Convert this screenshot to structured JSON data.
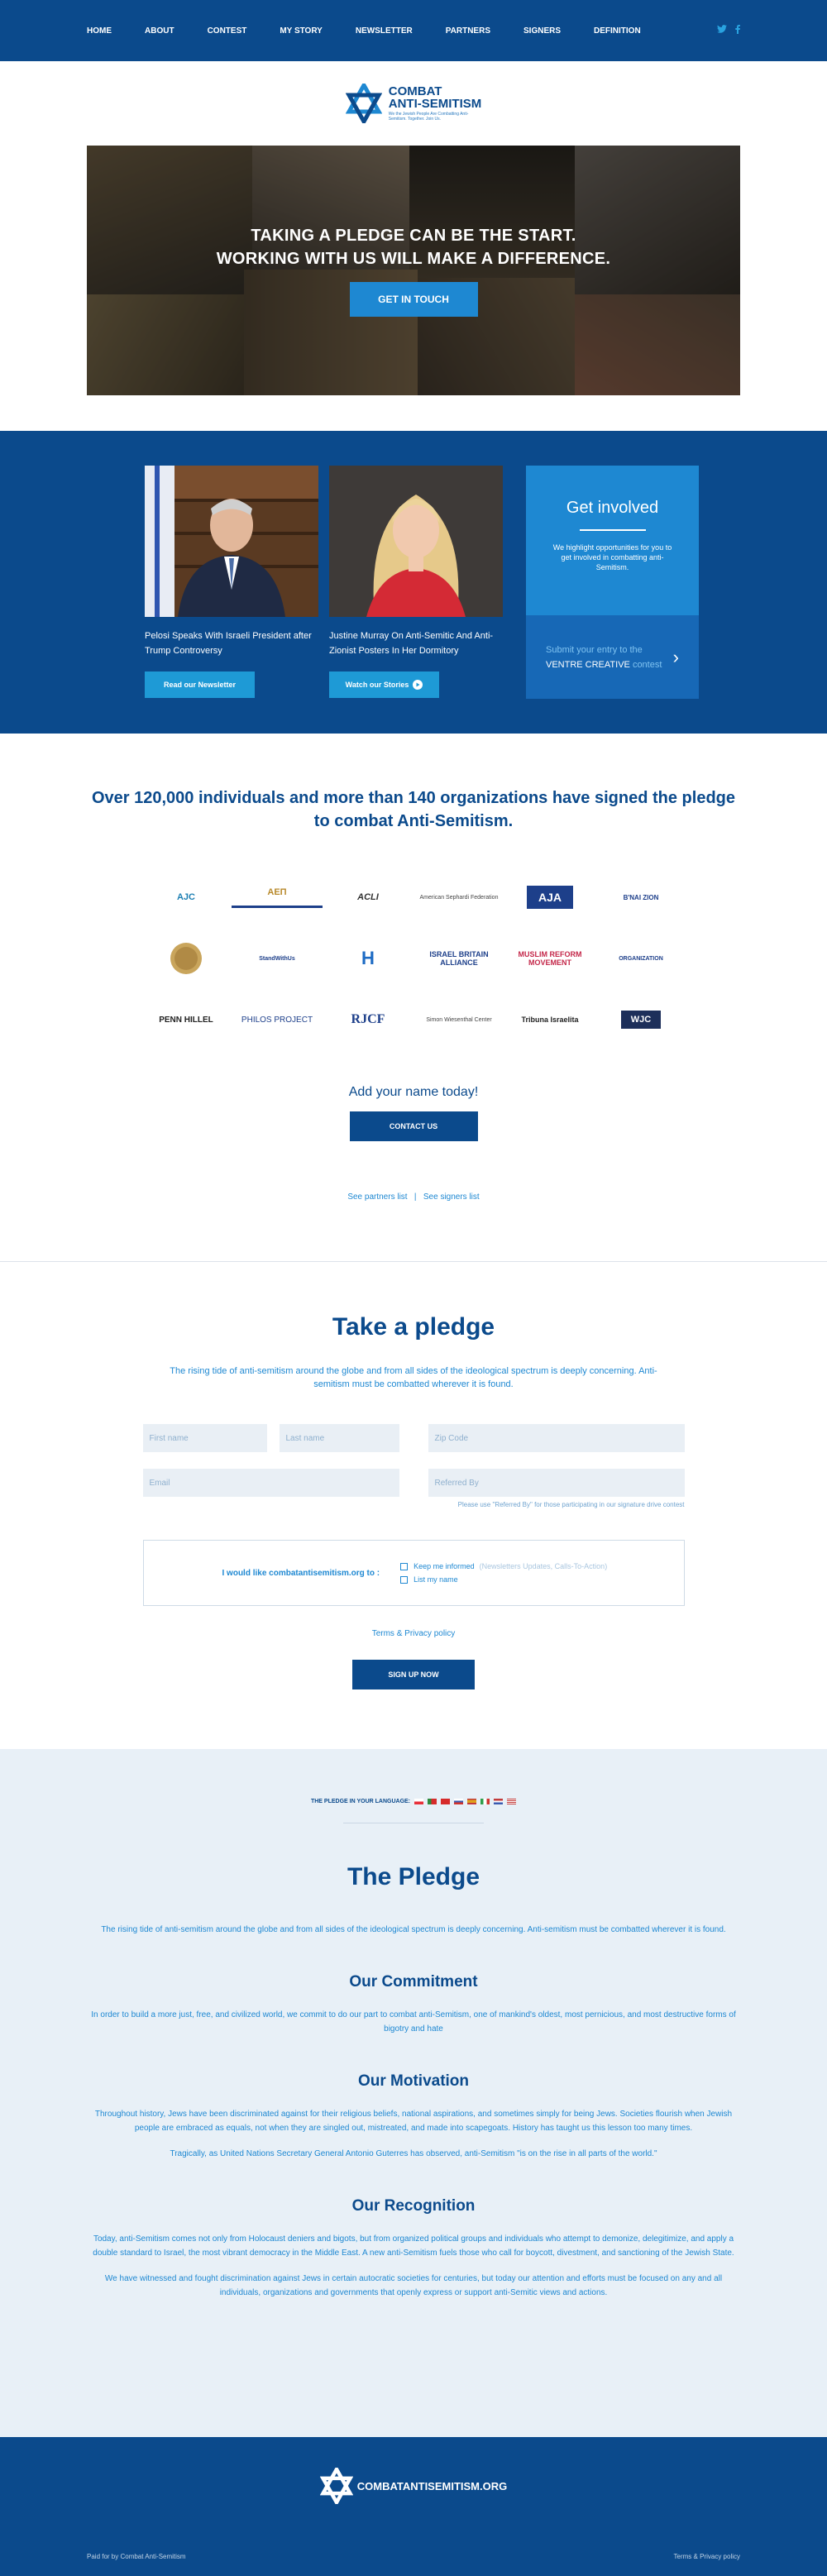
{
  "nav": {
    "items": [
      "HOME",
      "ABOUT",
      "CONTEST",
      "MY STORY",
      "NEWSLETTER",
      "PARTNERS",
      "SIGNERS",
      "DEFINITION"
    ],
    "social": [
      "twitter-icon",
      "facebook-icon"
    ]
  },
  "logo": {
    "line1": "COMBAT",
    "line2": "ANTI-SEMITISM",
    "tagline": "We the Jewish People Are Combatting Anti-Semitism. Together. Join Us."
  },
  "hero": {
    "line1": "TAKING A PLEDGE CAN BE THE START.",
    "line2": "WORKING WITH US WILL MAKE A DIFFERENCE.",
    "cta": "GET IN TOUCH"
  },
  "stories": {
    "card1_caption": "Pelosi Speaks With Israeli President after Trump Controversy",
    "card1_button": "Read our Newsletter",
    "card2_caption": "Justine Murray On Anti-Semitic And Anti-Zionist Posters In Her Dormitory",
    "card2_button": "Watch our Stories",
    "involve_title": "Get involved",
    "involve_desc": "We highlight opportunities for you to get involved in combatting anti-Semitism.",
    "involve_link_1": "Submit your entry to the",
    "involve_link_2": "VENTRE CREATIVE",
    "involve_link_3": "contest"
  },
  "signed": {
    "title": "Over 120,000 individuals and more than 140 organizations have signed the pledge to combat Anti-Semitism.",
    "partners": [
      "AJC",
      "ΑΕΠ",
      "ACLI",
      "American Sephardi Federation",
      "AJA",
      "B'NAI ZION",
      "seal",
      "StandWithUs",
      "H",
      "ISRAEL BRITAIN ALLIANCE",
      "MUSLIM REFORM MOVEMENT",
      "ORGANIZATION",
      "PENN HILLEL",
      "PHILOS PROJECT",
      "RJCF",
      "Simon Wiesenthal Center",
      "Tribuna Israelita",
      "WJC"
    ],
    "add_name": "Add your name today!",
    "contact": "CONTACT US",
    "link_partners": "See partners list",
    "link_sep": "|",
    "link_signers": "See signers list"
  },
  "pledge_form": {
    "title": "Take a pledge",
    "desc": "The rising tide of anti-semitism around the globe and from all sides of the ideological spectrum is deeply concerning. Anti-semitism must be combatted wherever it is found.",
    "first_name": "First name",
    "last_name": "Last name",
    "zip": "Zip Code",
    "email": "Email",
    "referred": "Referred By",
    "note": "Please use \"Referred By\" for those participating in our signature drive contest",
    "cb_label": "I would like combatantisemitism.org to :",
    "cb1": "Keep me informed",
    "cb1_sub": "(Newsletters Updates, Calls-To-Action)",
    "cb2": "List my name",
    "terms": "Terms & Privacy policy",
    "submit": "SIGN UP NOW"
  },
  "pledge_text": {
    "lang_label": "THE PLEDGE IN YOUR LANGUAGE:",
    "flag_colors": [
      "#e8303a",
      "#2e8b3e",
      "#d62b2b",
      "#d1342f",
      "#e0a21c",
      "#2e9e4a",
      "#3a5bb0",
      "#c23b3b"
    ],
    "title": "The Pledge",
    "intro": "The rising tide of anti-semitism around the globe and from all sides of the ideological spectrum is deeply concerning. Anti-semitism must be combatted wherever it is found.",
    "h_commitment": "Our Commitment",
    "p_commitment": "In order to build a more just, free, and civilized world, we commit to do our part to combat anti-Semitism, one of mankind's oldest, most pernicious, and most destructive forms of bigotry and hate",
    "h_motivation": "Our Motivation",
    "p_motivation": "Throughout history, Jews have been discriminated against for their religious beliefs, national aspirations, and sometimes simply for being Jews. Societies flourish when Jewish people are embraced as equals, not when they are singled out, mistreated, and made into scapegoats. History has taught us this lesson too many times.",
    "p_motivation2": "Tragically, as United Nations Secretary General Antonio Guterres has observed, anti-Semitism \"is on the rise in all parts of the world.\"",
    "h_recognition": "Our Recognition",
    "p_recognition": "Today, anti-Semitism comes not only from Holocaust deniers and bigots, but from organized political groups and individuals who attempt to demonize, delegitimize, and apply a double standard to Israel, the most vibrant democracy in the Middle East. A new anti-Semitism fuels those who call for boycott, divestment, and sanctioning of the Jewish State.",
    "p_recognition2": "We have witnessed and fought discrimination against Jews in certain autocratic societies for centuries, but today our attention and efforts must be focused on any and all individuals, organizations and governments that openly express or support anti-Semitic views and actions."
  },
  "footer": {
    "logo_text": "COMBATANTISEMITISM.ORG",
    "paid": "Paid for by Combat Anti-Semitism",
    "terms": "Terms & Privacy policy"
  },
  "colors": {
    "brand_blue": "#0b4a8c",
    "accent_blue": "#1e88d2",
    "light_bg": "#e8f0f7"
  }
}
